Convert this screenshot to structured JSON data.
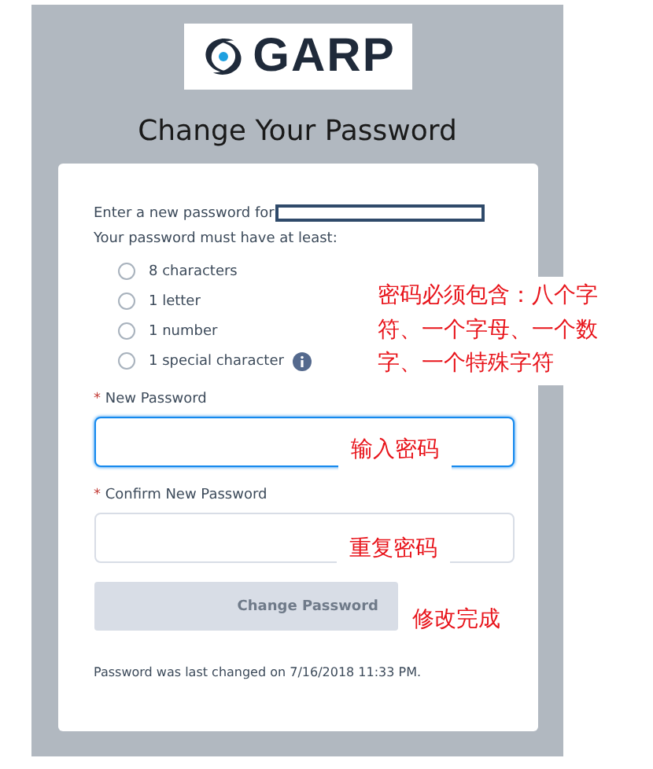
{
  "logo": {
    "text": "GARP"
  },
  "title": "Change Your Password",
  "intro": "Enter a new password for",
  "requirements_heading": "Your password must have at least:",
  "requirements": [
    {
      "label": "8 characters",
      "checked": false,
      "info": false
    },
    {
      "label": "1 letter",
      "checked": false,
      "info": false
    },
    {
      "label": "1 number",
      "checked": false,
      "info": false
    },
    {
      "label": "1 special character",
      "checked": false,
      "info": true
    }
  ],
  "fields": [
    {
      "label": "New Password",
      "required": "*",
      "focused": true
    },
    {
      "label": "Confirm New Password",
      "required": "*",
      "focused": false
    }
  ],
  "submit": {
    "label": "Change Password",
    "disabled": true
  },
  "footer": "Password was last changed on 7/16/2018 11:33 PM.",
  "annotations": [
    {
      "kind": "requirements",
      "text": "密码必须包含：八个字符、一个字母、一个数字、一个特殊字符"
    },
    {
      "kind": "new",
      "text": "输入密码"
    },
    {
      "kind": "confirm",
      "text": "重复密码"
    },
    {
      "kind": "submit",
      "text": "修改完成"
    }
  ]
}
